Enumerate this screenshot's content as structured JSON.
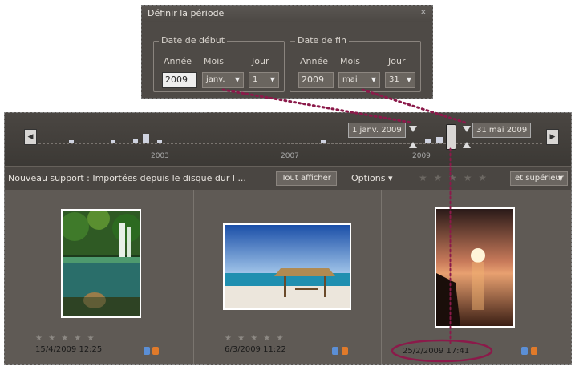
{
  "dialog": {
    "title": "Définir la période",
    "close": "×",
    "start": {
      "legend": "Date de début",
      "year_label": "Année",
      "month_label": "Mois",
      "day_label": "Jour",
      "year_value": "2009",
      "month_value": "janv.",
      "day_value": "1"
    },
    "end": {
      "legend": "Date de fin",
      "year_label": "Année",
      "month_label": "Mois",
      "day_label": "Jour",
      "year_value": "2009",
      "month_value": "mai",
      "day_value": "31"
    }
  },
  "timeline": {
    "years": [
      "2003",
      "2007",
      "2009"
    ],
    "start_flag": "1 janv. 2009",
    "end_flag": "31 mai 2009",
    "left_arrow": "◀",
    "right_arrow": "▶"
  },
  "toolbar": {
    "source_text": "Nouveau support : Importées depuis le disque dur l ...",
    "show_all": "Tout afficher",
    "options": "Options ▾",
    "stars": "★ ★ ★ ★ ★",
    "rating_filter": "et supérieur"
  },
  "photos": [
    {
      "stars": "★ ★ ★ ★ ★",
      "date": "15/4/2009 12:25"
    },
    {
      "stars": "★ ★ ★ ★ ★",
      "date": "6/3/2009 11:22"
    },
    {
      "stars": "",
      "date": "25/2/2009 17:41"
    }
  ],
  "colors": {
    "annotation": "#8b1a4a",
    "lock_blue": "#5b8fd6",
    "lock_orange": "#e07a2a"
  }
}
